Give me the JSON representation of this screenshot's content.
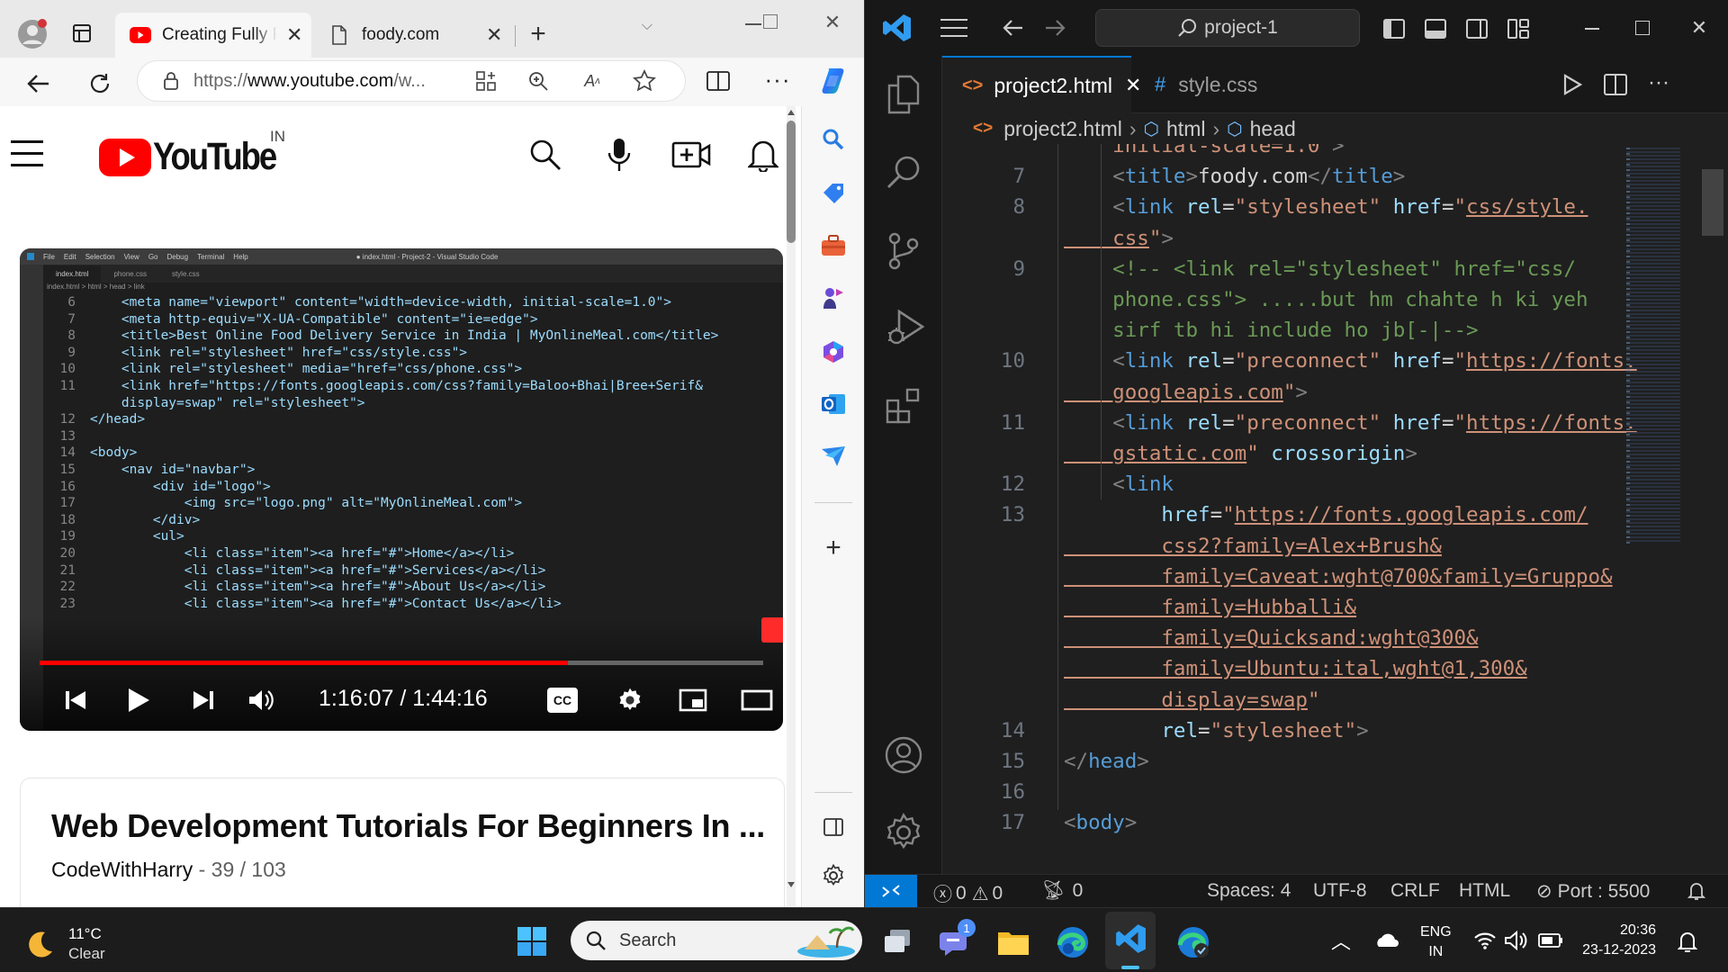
{
  "edge": {
    "tabs": [
      {
        "title": "Creating Fully R",
        "active": true
      },
      {
        "title": "foody.com",
        "active": false
      }
    ],
    "address": {
      "prefix": "https://",
      "host": "www.youtube.com",
      "path": "/w..."
    },
    "youtube": {
      "logo_text": "YouTube",
      "country": "IN",
      "video_controls": {
        "time": "1:16:07 / 1:44:16",
        "progress": 0.73
      },
      "playlist": {
        "title": "Web Development Tutorials For Beginners In ...",
        "channel": "CodeWithHarry",
        "position": "39 / 103"
      },
      "video_screen": {
        "menu": [
          "File",
          "Edit",
          "Selection",
          "View",
          "Go",
          "Debug",
          "Terminal",
          "Help"
        ],
        "window_title": "● index.html - Project-2 - Visual Studio Code",
        "tabs": [
          "index.html",
          "phone.css",
          "style.css"
        ],
        "breadcrumb": "index.html > html > head > link",
        "lines": [
          {
            "n": "6",
            "code": "    <meta name=\"viewport\" content=\"width=device-width, initial-scale=1.0\">"
          },
          {
            "n": "7",
            "code": "    <meta http-equiv=\"X-UA-Compatible\" content=\"ie=edge\">"
          },
          {
            "n": "8",
            "code": "    <title>Best Online Food Delivery Service in India | MyOnlineMeal.com</title>"
          },
          {
            "n": "9",
            "code": "    <link rel=\"stylesheet\" href=\"css/style.css\">"
          },
          {
            "n": "10",
            "code": "    <link rel=\"stylesheet\" media=\"href=\"css/phone.css\">"
          },
          {
            "n": "11",
            "code": "    <link href=\"https://fonts.googleapis.com/css?family=Baloo+Bhai|Bree+Serif&"
          },
          {
            "n": "",
            "code": "    display=swap\" rel=\"stylesheet\">"
          },
          {
            "n": "12",
            "code": "</head>"
          },
          {
            "n": "13",
            "code": ""
          },
          {
            "n": "14",
            "code": "<body>"
          },
          {
            "n": "15",
            "code": "    <nav id=\"navbar\">"
          },
          {
            "n": "16",
            "code": "        <div id=\"logo\">"
          },
          {
            "n": "17",
            "code": "            <img src=\"logo.png\" alt=\"MyOnlineMeal.com\">"
          },
          {
            "n": "18",
            "code": "        </div>"
          },
          {
            "n": "19",
            "code": "        <ul>"
          },
          {
            "n": "20",
            "code": "            <li class=\"item\"><a href=\"#\">Home</a></li>"
          },
          {
            "n": "21",
            "code": "            <li class=\"item\"><a href=\"#\">Services</a></li>"
          },
          {
            "n": "22",
            "code": "            <li class=\"item\"><a href=\"#\">About Us</a></li>"
          },
          {
            "n": "23",
            "code": "            <li class=\"item\"><a href=\"#\">Contact Us</a></li>"
          }
        ]
      }
    }
  },
  "vscode": {
    "search": "project-1",
    "tabs": [
      {
        "label": "project2.html",
        "active": true
      },
      {
        "label": "style.css",
        "active": false
      }
    ],
    "breadcrumb": [
      "project2.html",
      "html",
      "head"
    ],
    "code": [
      {
        "n": "",
        "t": [
          [
            "st",
            "    initial-scale=1.0\""
          ],
          [
            "tg",
            ">"
          ]
        ]
      },
      {
        "n": "7",
        "t": [
          [
            "tx",
            "    "
          ],
          [
            "tg",
            "<"
          ],
          [
            "tn",
            "title"
          ],
          [
            "tg",
            ">"
          ],
          [
            "tx",
            "foody.com"
          ],
          [
            "tg",
            "</"
          ],
          [
            "tn",
            "title"
          ],
          [
            "tg",
            ">"
          ]
        ]
      },
      {
        "n": "8",
        "t": [
          [
            "tx",
            "    "
          ],
          [
            "tg",
            "<"
          ],
          [
            "tn",
            "link"
          ],
          [
            "tx",
            " "
          ],
          [
            "at",
            "rel"
          ],
          [
            "tx",
            "="
          ],
          [
            "st",
            "\"stylesheet\""
          ],
          [
            "tx",
            " "
          ],
          [
            "at",
            "href"
          ],
          [
            "tx",
            "="
          ],
          [
            "st",
            "\""
          ],
          [
            "stu",
            "css/style."
          ]
        ]
      },
      {
        "n": "",
        "t": [
          [
            "stu",
            "    css"
          ],
          [
            "st",
            "\""
          ],
          [
            "tg",
            ">"
          ]
        ]
      },
      {
        "n": "9",
        "t": [
          [
            "cm",
            "    <!-- <link rel=\"stylesheet\" href=\"css/"
          ]
        ]
      },
      {
        "n": "",
        "t": [
          [
            "cm",
            "    phone.css\"> .....but hm chahte h ki yeh"
          ]
        ]
      },
      {
        "n": "",
        "t": [
          [
            "cm",
            "    sirf tb hi include ho jb[-|-->"
          ]
        ]
      },
      {
        "n": "10",
        "t": [
          [
            "tx",
            "    "
          ],
          [
            "tg",
            "<"
          ],
          [
            "tn",
            "link"
          ],
          [
            "tx",
            " "
          ],
          [
            "at",
            "rel"
          ],
          [
            "tx",
            "="
          ],
          [
            "st",
            "\"preconnect\""
          ],
          [
            "tx",
            " "
          ],
          [
            "at",
            "href"
          ],
          [
            "tx",
            "="
          ],
          [
            "st",
            "\""
          ],
          [
            "stu",
            "https://fonts."
          ]
        ]
      },
      {
        "n": "",
        "t": [
          [
            "stu",
            "    googleapis.com"
          ],
          [
            "st",
            "\""
          ],
          [
            "tg",
            ">"
          ]
        ]
      },
      {
        "n": "11",
        "t": [
          [
            "tx",
            "    "
          ],
          [
            "tg",
            "<"
          ],
          [
            "tn",
            "link"
          ],
          [
            "tx",
            " "
          ],
          [
            "at",
            "rel"
          ],
          [
            "tx",
            "="
          ],
          [
            "st",
            "\"preconnect\""
          ],
          [
            "tx",
            " "
          ],
          [
            "at",
            "href"
          ],
          [
            "tx",
            "="
          ],
          [
            "st",
            "\""
          ],
          [
            "stu",
            "https://fonts."
          ]
        ]
      },
      {
        "n": "",
        "t": [
          [
            "stu",
            "    gstatic.com"
          ],
          [
            "st",
            "\""
          ],
          [
            "tx",
            " "
          ],
          [
            "at",
            "crossorigin"
          ],
          [
            "tg",
            ">"
          ]
        ]
      },
      {
        "n": "12",
        "t": [
          [
            "tx",
            "    "
          ],
          [
            "tg",
            "<"
          ],
          [
            "tn",
            "link"
          ]
        ]
      },
      {
        "n": "13",
        "t": [
          [
            "tx",
            "        "
          ],
          [
            "at",
            "href"
          ],
          [
            "tx",
            "="
          ],
          [
            "st",
            "\""
          ],
          [
            "stu",
            "https://fonts.googleapis.com/"
          ]
        ]
      },
      {
        "n": "",
        "t": [
          [
            "stu",
            "        css2?family=Alex+Brush&"
          ]
        ]
      },
      {
        "n": "",
        "t": [
          [
            "stu",
            "        family=Caveat:wght@700&family=Gruppo&"
          ]
        ]
      },
      {
        "n": "",
        "t": [
          [
            "stu",
            "        family=Hubballi&"
          ]
        ]
      },
      {
        "n": "",
        "t": [
          [
            "stu",
            "        family=Quicksand:wght@300&"
          ]
        ]
      },
      {
        "n": "",
        "t": [
          [
            "stu",
            "        family=Ubuntu:ital,wght@1,300&"
          ]
        ]
      },
      {
        "n": "",
        "t": [
          [
            "stu",
            "        display=swap"
          ],
          [
            "st",
            "\""
          ]
        ]
      },
      {
        "n": "14",
        "t": [
          [
            "tx",
            "        "
          ],
          [
            "at",
            "rel"
          ],
          [
            "tx",
            "="
          ],
          [
            "st",
            "\"stylesheet\""
          ],
          [
            "tg",
            ">"
          ]
        ]
      },
      {
        "n": "15",
        "t": [
          [
            "tg",
            "</"
          ],
          [
            "tn",
            "head"
          ],
          [
            "tg",
            ">"
          ]
        ]
      },
      {
        "n": "16",
        "t": []
      },
      {
        "n": "17",
        "t": [
          [
            "tg",
            "<"
          ],
          [
            "tn",
            "body"
          ],
          [
            "tg",
            ">"
          ]
        ]
      }
    ],
    "status": {
      "errors": "0",
      "warnings": "0",
      "ports": "0",
      "spaces": "Spaces: 4",
      "encoding": "UTF-8",
      "eol": "CRLF",
      "language": "HTML",
      "port": "Port : 5500"
    }
  },
  "taskbar": {
    "weather": {
      "temp": "11°C",
      "condition": "Clear"
    },
    "search_placeholder": "Search",
    "teams_badge": "1",
    "lang": {
      "line1": "ENG",
      "line2": "IN"
    },
    "time": "20:36",
    "date": "23-12-2023"
  }
}
